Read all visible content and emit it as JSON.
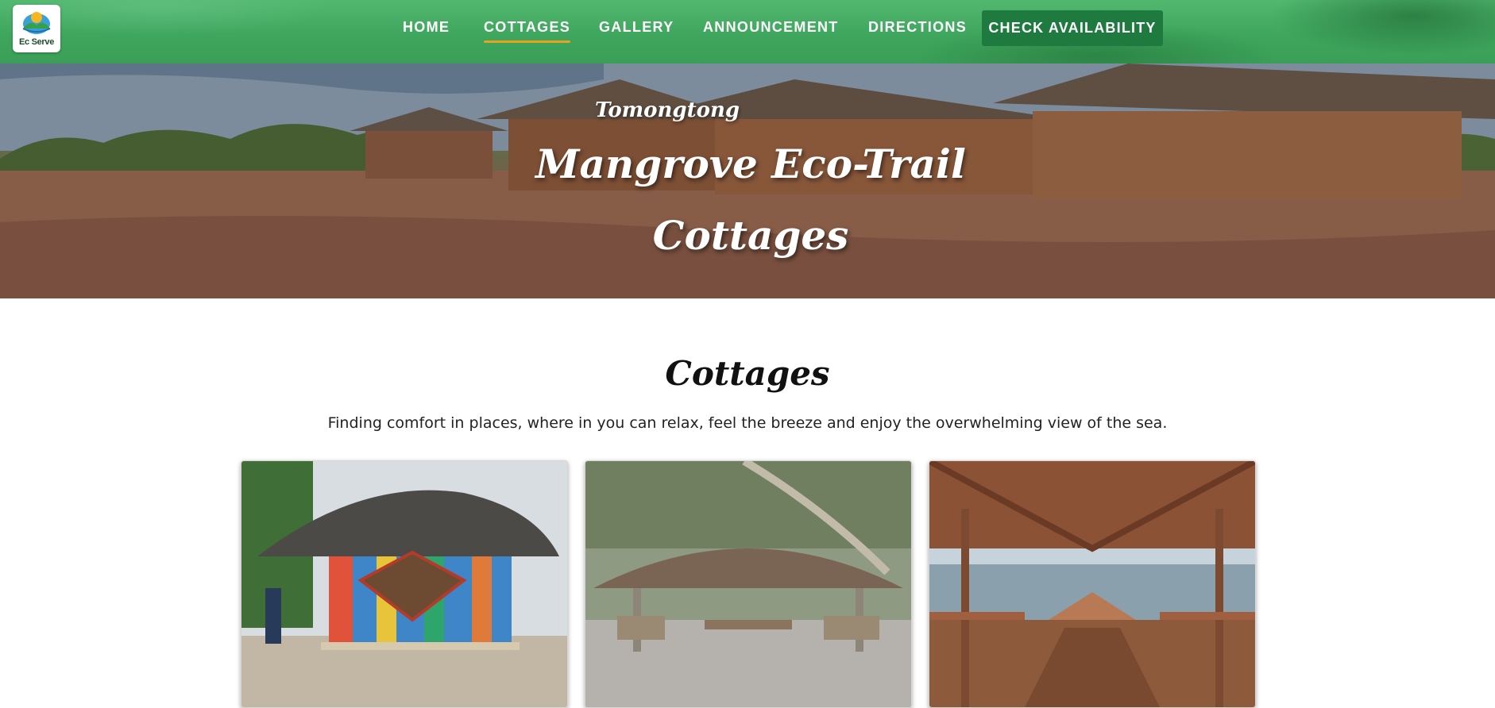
{
  "brand": {
    "logo_text": "Ec  Serve",
    "logo_alt": "EcoServe logo"
  },
  "nav": {
    "items": [
      {
        "label": "HOME",
        "active": false
      },
      {
        "label": "COTTAGES",
        "active": true
      },
      {
        "label": "GALLERY",
        "active": false
      },
      {
        "label": "ANNOUNCEMENT",
        "active": false
      },
      {
        "label": "DIRECTIONS",
        "active": false
      }
    ],
    "cta_label": "CHECK AVAILABILITY"
  },
  "hero": {
    "subtitle": "Tomongtong",
    "title_line1": "Mangrove Eco-Trail",
    "title_line2": "Cottages"
  },
  "section": {
    "title": "Cottages",
    "description": "Finding comfort in places, where in you can relax, feel the breeze and enjoy the overwhelming view of the sea."
  },
  "colors": {
    "nav_green": "#3fa65d",
    "cta_green": "#1f7a3f",
    "active_underline": "#e9a21f"
  }
}
